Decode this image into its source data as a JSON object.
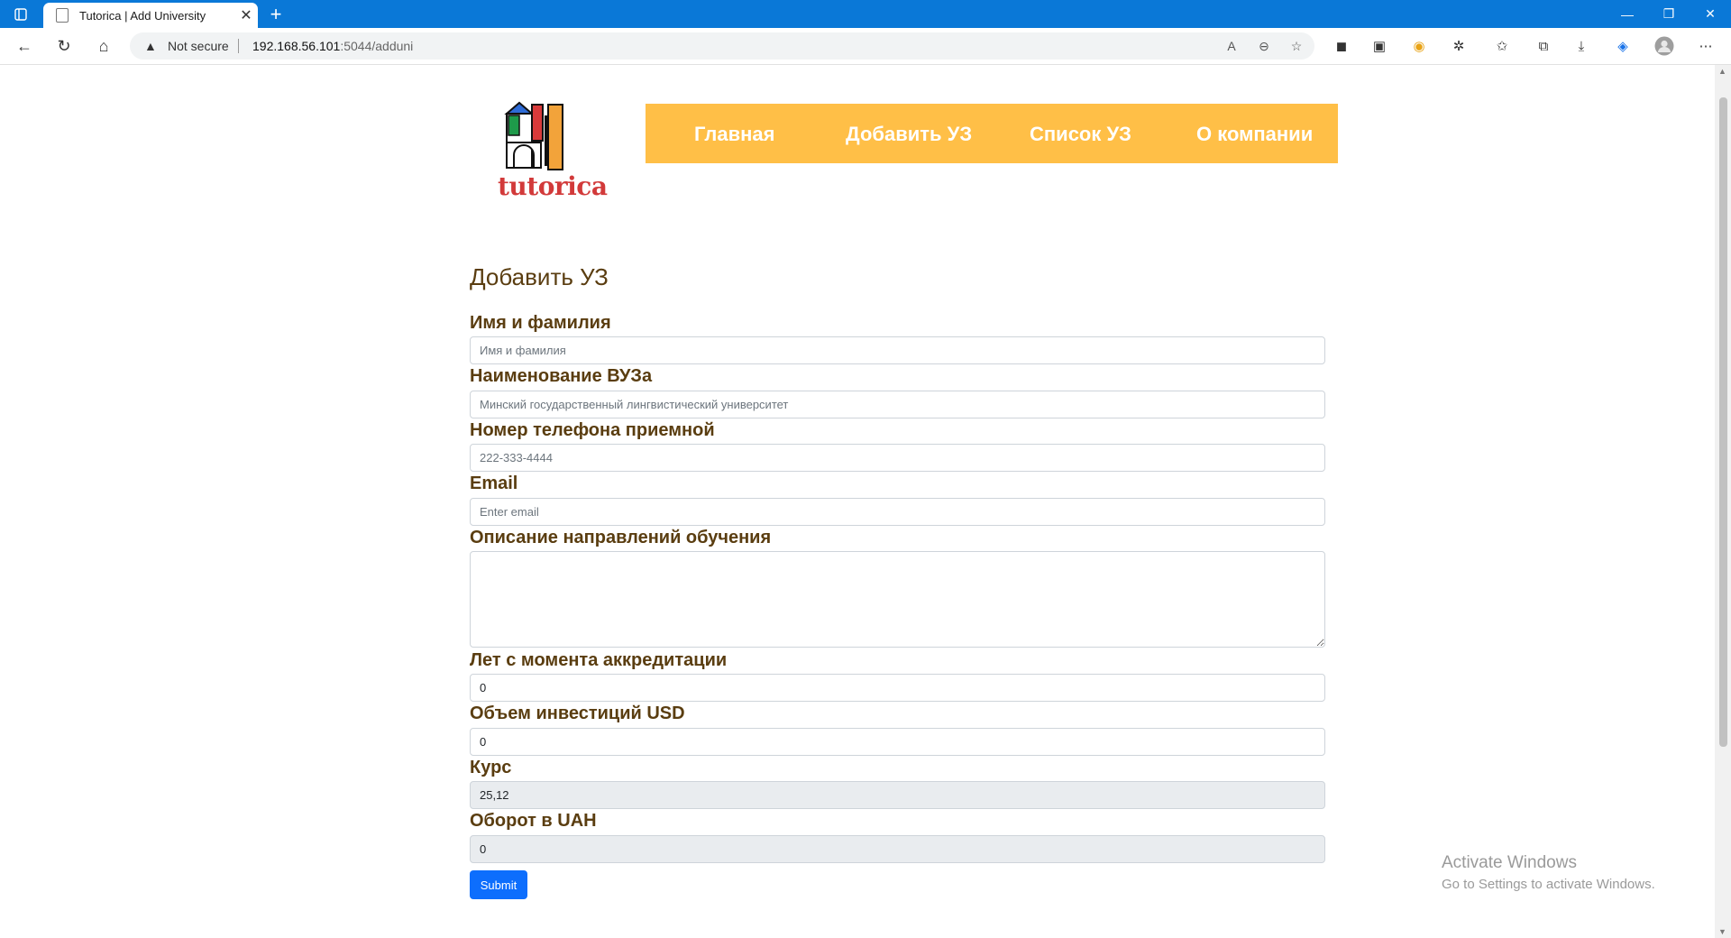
{
  "browser": {
    "tab_title": "Tutorica | Add University",
    "security_label": "Not secure",
    "url_host": "192.168.56.101",
    "url_path": ":5044/adduni"
  },
  "site": {
    "logo_text": "tutorica",
    "nav": [
      "Главная",
      "Добавить УЗ",
      "Список УЗ",
      "О компании"
    ]
  },
  "form": {
    "title": "Добавить УЗ",
    "fields": [
      {
        "label": "Имя и фамилия",
        "placeholder": "Имя и фамилия",
        "value": ""
      },
      {
        "label": "Наименование ВУЗа",
        "placeholder": "Минский государственный лингвистический университет",
        "value": ""
      },
      {
        "label": "Номер телефона приемной",
        "placeholder": "222-333-4444",
        "value": ""
      },
      {
        "label": "Email",
        "placeholder": "Enter email",
        "value": ""
      },
      {
        "label": "Описание направлений обучения",
        "placeholder": "",
        "value": ""
      },
      {
        "label": "Лет с момента аккредитации",
        "placeholder": "",
        "value": "0"
      },
      {
        "label": "Объем инвестиций USD",
        "placeholder": "",
        "value": "0"
      },
      {
        "label": "Курс",
        "placeholder": "",
        "value": "25,12"
      },
      {
        "label": "Оборот в UAH",
        "placeholder": "",
        "value": "0"
      }
    ],
    "submit_label": "Submit"
  },
  "watermark": {
    "line1": "Activate Windows",
    "line2": "Go to Settings to activate Windows."
  },
  "colors": {
    "nav_bg": "#ffbf47",
    "label_color": "#5a3d10",
    "submit_bg": "#0d6efd",
    "titlebar_bg": "#0a78d7"
  }
}
